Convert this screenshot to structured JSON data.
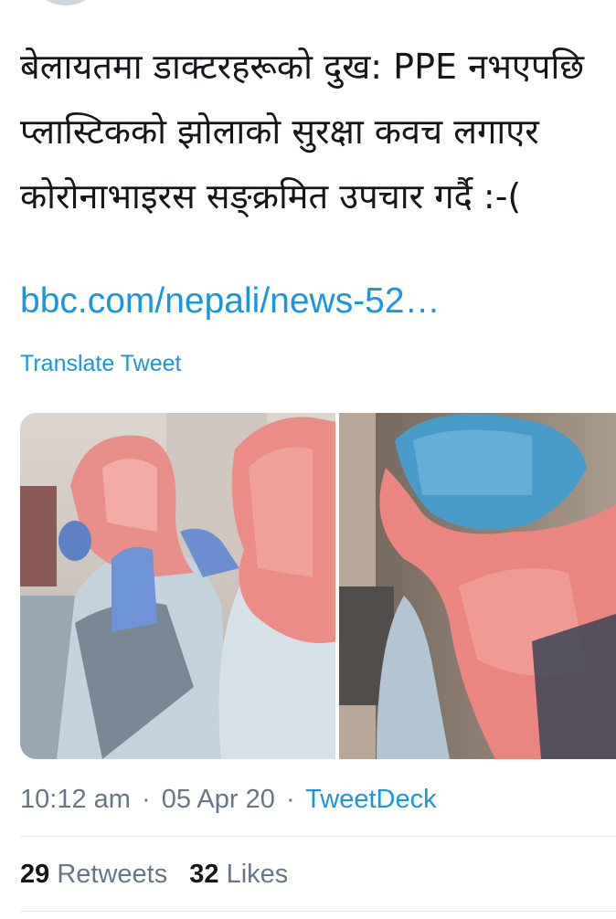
{
  "tweet": {
    "text": "बेलायतमा डाक्टरहरूको दुख: PPE नभएपछि प्लास्टिकको झोलाको सुरक्षा कवच लगाएर कोरोनाभाइरस सङ्क्रमित उपचार गर्दै :-(",
    "link": "bbc.com/nepali/news-52…",
    "translate_label": "Translate Tweet"
  },
  "meta": {
    "time": "10:12 am",
    "separator": "·",
    "date": "05 Apr 20",
    "source": "TweetDeck"
  },
  "stats": {
    "retweets_count": "29",
    "retweets_label": "Retweets",
    "likes_count": "32",
    "likes_label": "Likes"
  },
  "colors": {
    "link": "#1b95e0",
    "secondary_text": "#657786",
    "divider": "#e1e8ed"
  }
}
